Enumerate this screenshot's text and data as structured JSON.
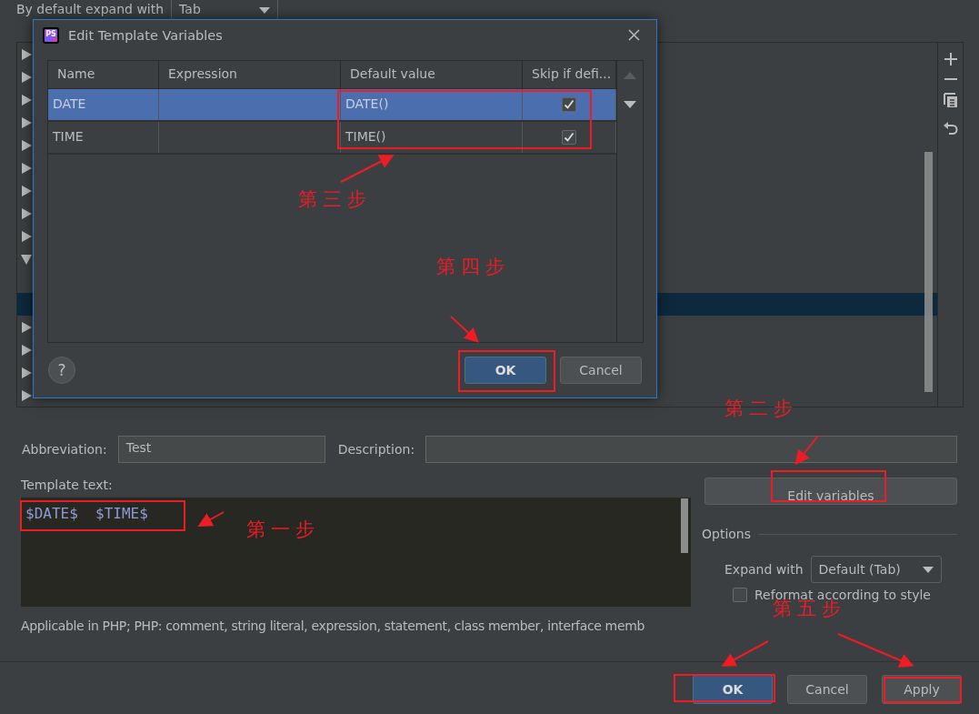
{
  "top_setting": {
    "label": "By default expand with",
    "value": "Tab"
  },
  "template_tree": {
    "groups": [
      {
        "expanded": false
      },
      {
        "expanded": false
      },
      {
        "expanded": false
      },
      {
        "expanded": false
      },
      {
        "expanded": false
      },
      {
        "expanded": false
      },
      {
        "expanded": false
      },
      {
        "expanded": false
      },
      {
        "expanded": false
      },
      {
        "expanded": true,
        "children": [
          {
            "selected": false
          },
          {
            "selected": true
          }
        ]
      },
      {
        "expanded": false
      },
      {
        "expanded": false
      },
      {
        "expanded": false
      },
      {
        "expanded": false
      }
    ]
  },
  "abbreviation": {
    "label": "Abbreviation:",
    "value": "Test"
  },
  "description": {
    "label": "Description:"
  },
  "template_text": {
    "label": "Template text:",
    "value": "$DATE$  $TIME$"
  },
  "applicable": "Applicable in PHP; PHP: comment, string literal, expression, statement, class member, interface memb",
  "edit_variables_button": "Edit variables",
  "options": {
    "title": "Options",
    "expand_label": "Expand with",
    "expand_value": "Default (Tab)",
    "reformat": {
      "label": "Reformat according to style",
      "checked": false
    }
  },
  "buttons": [
    {
      "label": "OK",
      "primary": true
    },
    {
      "label": "Cancel",
      "primary": false
    },
    {
      "label": "Apply",
      "primary": false
    }
  ],
  "dialog": {
    "logo_text": "PS",
    "title": "Edit Template Variables",
    "columns": [
      "Name",
      "Expression",
      "Default value",
      "Skip if defi..."
    ],
    "rows": [
      {
        "name": "DATE",
        "default_value": "DATE()",
        "skip": true,
        "selected": true
      },
      {
        "name": "TIME",
        "default_value": "TIME()",
        "skip": true,
        "selected": false
      }
    ],
    "help": "?",
    "buttons": [
      {
        "label": "OK",
        "primary": true
      },
      {
        "label": "Cancel",
        "primary": false
      }
    ]
  },
  "annotations": [
    "第三步",
    "第四步",
    "第二步",
    "第一步",
    "第五步"
  ]
}
